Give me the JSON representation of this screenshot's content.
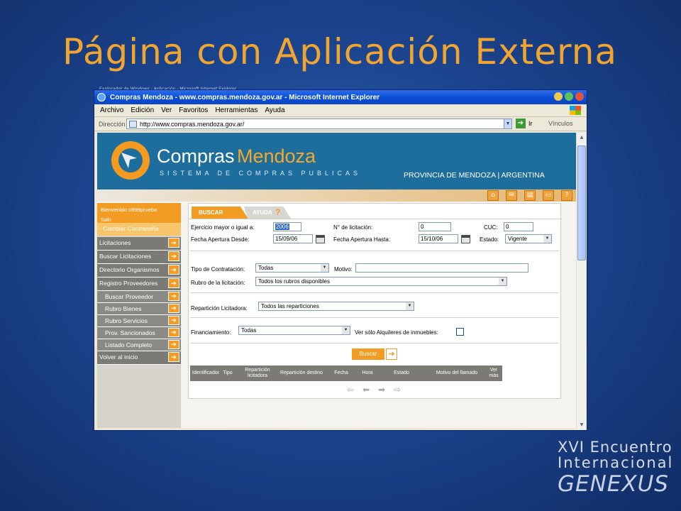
{
  "slide": {
    "title": "Página con Aplicación Externa",
    "footer_line1": "XVI Encuentro",
    "footer_line2": "Internacional",
    "footer_logo": "GENEXUS",
    "footer_tm": "™"
  },
  "browser": {
    "bg_tabs_text": "Explorador de Windows - Aplicación - Microsoft Internet Explorer",
    "title": "Compras Mendoza - www.compras.mendoza.gov.ar - Microsoft Internet Explorer",
    "menu": [
      "Archivo",
      "Edición",
      "Ver",
      "Favoritos",
      "Herramientas",
      "Ayuda"
    ],
    "address_label": "Dirección",
    "address_value": "http://www.compras.mendoza.gov.ar/",
    "go_label": "Ir",
    "links_label": "Vínculos",
    "colors": {
      "titlebar": "#0a4fd6",
      "min": "#f2c94c",
      "max": "#5cc05c",
      "close": "#e2553a"
    }
  },
  "site": {
    "brand_part1": "Compras",
    "brand_part2": "Mendoza",
    "brand_sub": "SISTEMA DE COMPRAS PUBLICAS",
    "province": "PROVINCIA DE MENDOZA | ARGENTINA",
    "toolbar_icons": [
      "home-icon",
      "mail-icon",
      "document-icon",
      "print-icon",
      "help-icon"
    ],
    "colors": {
      "banner": "#1d6e9c",
      "accent": "#f39c23"
    }
  },
  "sidebar": {
    "welcome": "Bienvenido o999prueba",
    "logout": "Salir",
    "change_password": "- Cambiar Contraseña",
    "items": [
      {
        "label": "Licitaciones",
        "type": "main"
      },
      {
        "label": "Buscar Licitaciones",
        "type": "main"
      },
      {
        "label": "Directorio Organismos",
        "type": "main"
      },
      {
        "label": "Registro Proveedores",
        "type": "main"
      },
      {
        "label": "Buscar Proveedor",
        "type": "sub"
      },
      {
        "label": "Rubro Bienes",
        "type": "sub"
      },
      {
        "label": "Rubro Servicios",
        "type": "sub"
      },
      {
        "label": "Prov. Sancionados",
        "type": "sub"
      },
      {
        "label": "Listado Completo",
        "type": "sub"
      },
      {
        "label": "Volver al inicio",
        "type": "main"
      }
    ]
  },
  "form": {
    "tab_search": "BUSCAR",
    "tab_help": "AYUDA",
    "fields": {
      "year_label": "Ejercicio mayor o igual a:",
      "year_value": "2006",
      "licitacion_label": "N° de licitación:",
      "licitacion_value": "0",
      "cuc_label": "CUC:",
      "cuc_value": "0",
      "open_from_label": "Fecha Apertura Desde:",
      "open_from_value": "15/09/06",
      "open_to_label": "Fecha Apertura Hasta:",
      "open_to_value": "15/10/06",
      "status_label": "Estado:",
      "status_value": "Vigente",
      "contract_type_label": "Tipo de Contratación:",
      "contract_type_value": "Todas",
      "motive_label": "Motivo:",
      "motive_value": "",
      "rubro_label": "Rubro de la licitación:",
      "rubro_value": "Todos los rubros disponibles",
      "reparticion_label": "Repartición Licitadora:",
      "reparticion_value": "Todos las reparticiones",
      "financing_label": "Financiamiento:",
      "financing_value": "Todas",
      "rent_only_label": "Ver sólo Alquileres de inmuebles:",
      "rent_only_checked": false
    },
    "search_button": "Buscar",
    "columns": [
      "Identificador",
      "Tipo",
      "Repartición licitadora",
      "Repartición destino",
      "Fecha",
      "Hora",
      "Estado",
      "Motivo del llamado",
      "Ver más"
    ],
    "pager_icons": [
      "first-page-icon",
      "prev-page-icon",
      "next-page-icon",
      "last-page-icon"
    ]
  }
}
